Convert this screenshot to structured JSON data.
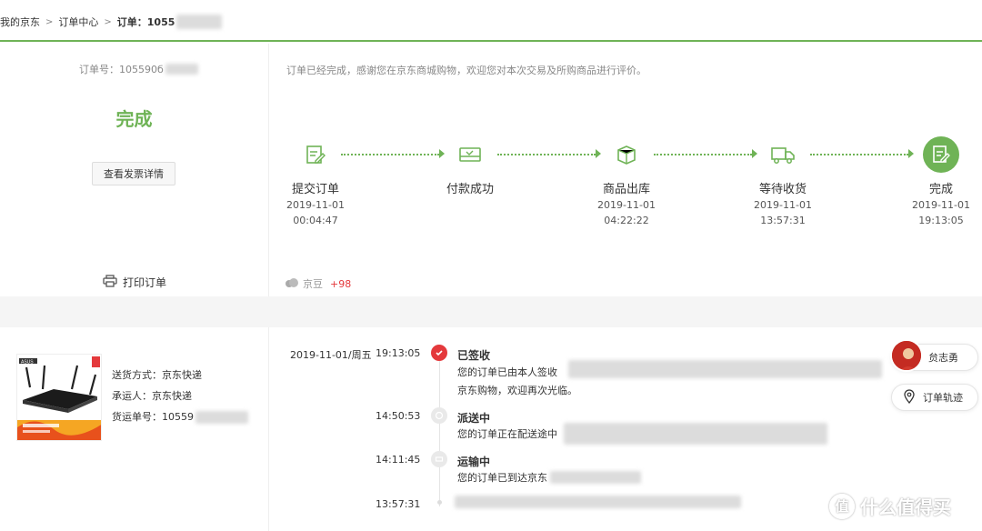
{
  "breadcrumb": {
    "items": [
      "我的京东",
      "订单中心"
    ],
    "current": "订单：1055"
  },
  "order": {
    "number_label": "订单号：",
    "number_visible": "105590б",
    "status": "完成",
    "invoice_button": "查看发票详情",
    "print_label": "打印订单"
  },
  "thanks_message": "订单已经完成，感谢您在京东商城购物，欢迎您对本次交易及所购商品进行评价。",
  "steps": [
    {
      "name": "提交订单",
      "date": "2019-11-01",
      "time": "00:04:47",
      "icon": "edit-order-icon"
    },
    {
      "name": "付款成功",
      "date": "",
      "time": "",
      "icon": "payment-card-icon"
    },
    {
      "name": "商品出库",
      "date": "2019-11-01",
      "time": "04:22:22",
      "icon": "package-box-icon"
    },
    {
      "name": "等待收货",
      "date": "2019-11-01",
      "time": "13:57:31",
      "icon": "delivery-truck-icon"
    },
    {
      "name": "完成",
      "date": "2019-11-01",
      "time": "19:13:05",
      "icon": "completed-check-icon"
    }
  ],
  "jingdou": {
    "label": "京豆",
    "value": "+98"
  },
  "shipping": {
    "method_label": "送货方式：",
    "method": "京东快递",
    "carrier_label": "承运人：",
    "carrier": "京东快递",
    "tracking_label": "货运单号：",
    "tracking_visible": "10559"
  },
  "tracking": [
    {
      "date": "2019-11-01/周五",
      "time": "19:13:05",
      "title": "已签收",
      "desc1": "您的订单已由本人签收",
      "desc2": "京东购物，欢迎再次光临。"
    },
    {
      "date": "",
      "time": "14:50:53",
      "title": "派送中",
      "desc1": "您的订单正在配送途中",
      "desc2": ""
    },
    {
      "date": "",
      "time": "14:11:45",
      "title": "运输中",
      "desc1": "您的订单已到达京东",
      "desc2": ""
    },
    {
      "date": "",
      "time": "13:57:31",
      "title": "",
      "desc1": "",
      "desc2": ""
    }
  ],
  "float": {
    "courier_name": "贠志勇",
    "track_label": "订单轨迹"
  },
  "watermark": {
    "symbol": "值",
    "text": "什么值得买"
  },
  "product": {
    "brand": "ASUS"
  },
  "colors": {
    "accent_green": "#6fb356",
    "accent_red": "#e4393c"
  }
}
